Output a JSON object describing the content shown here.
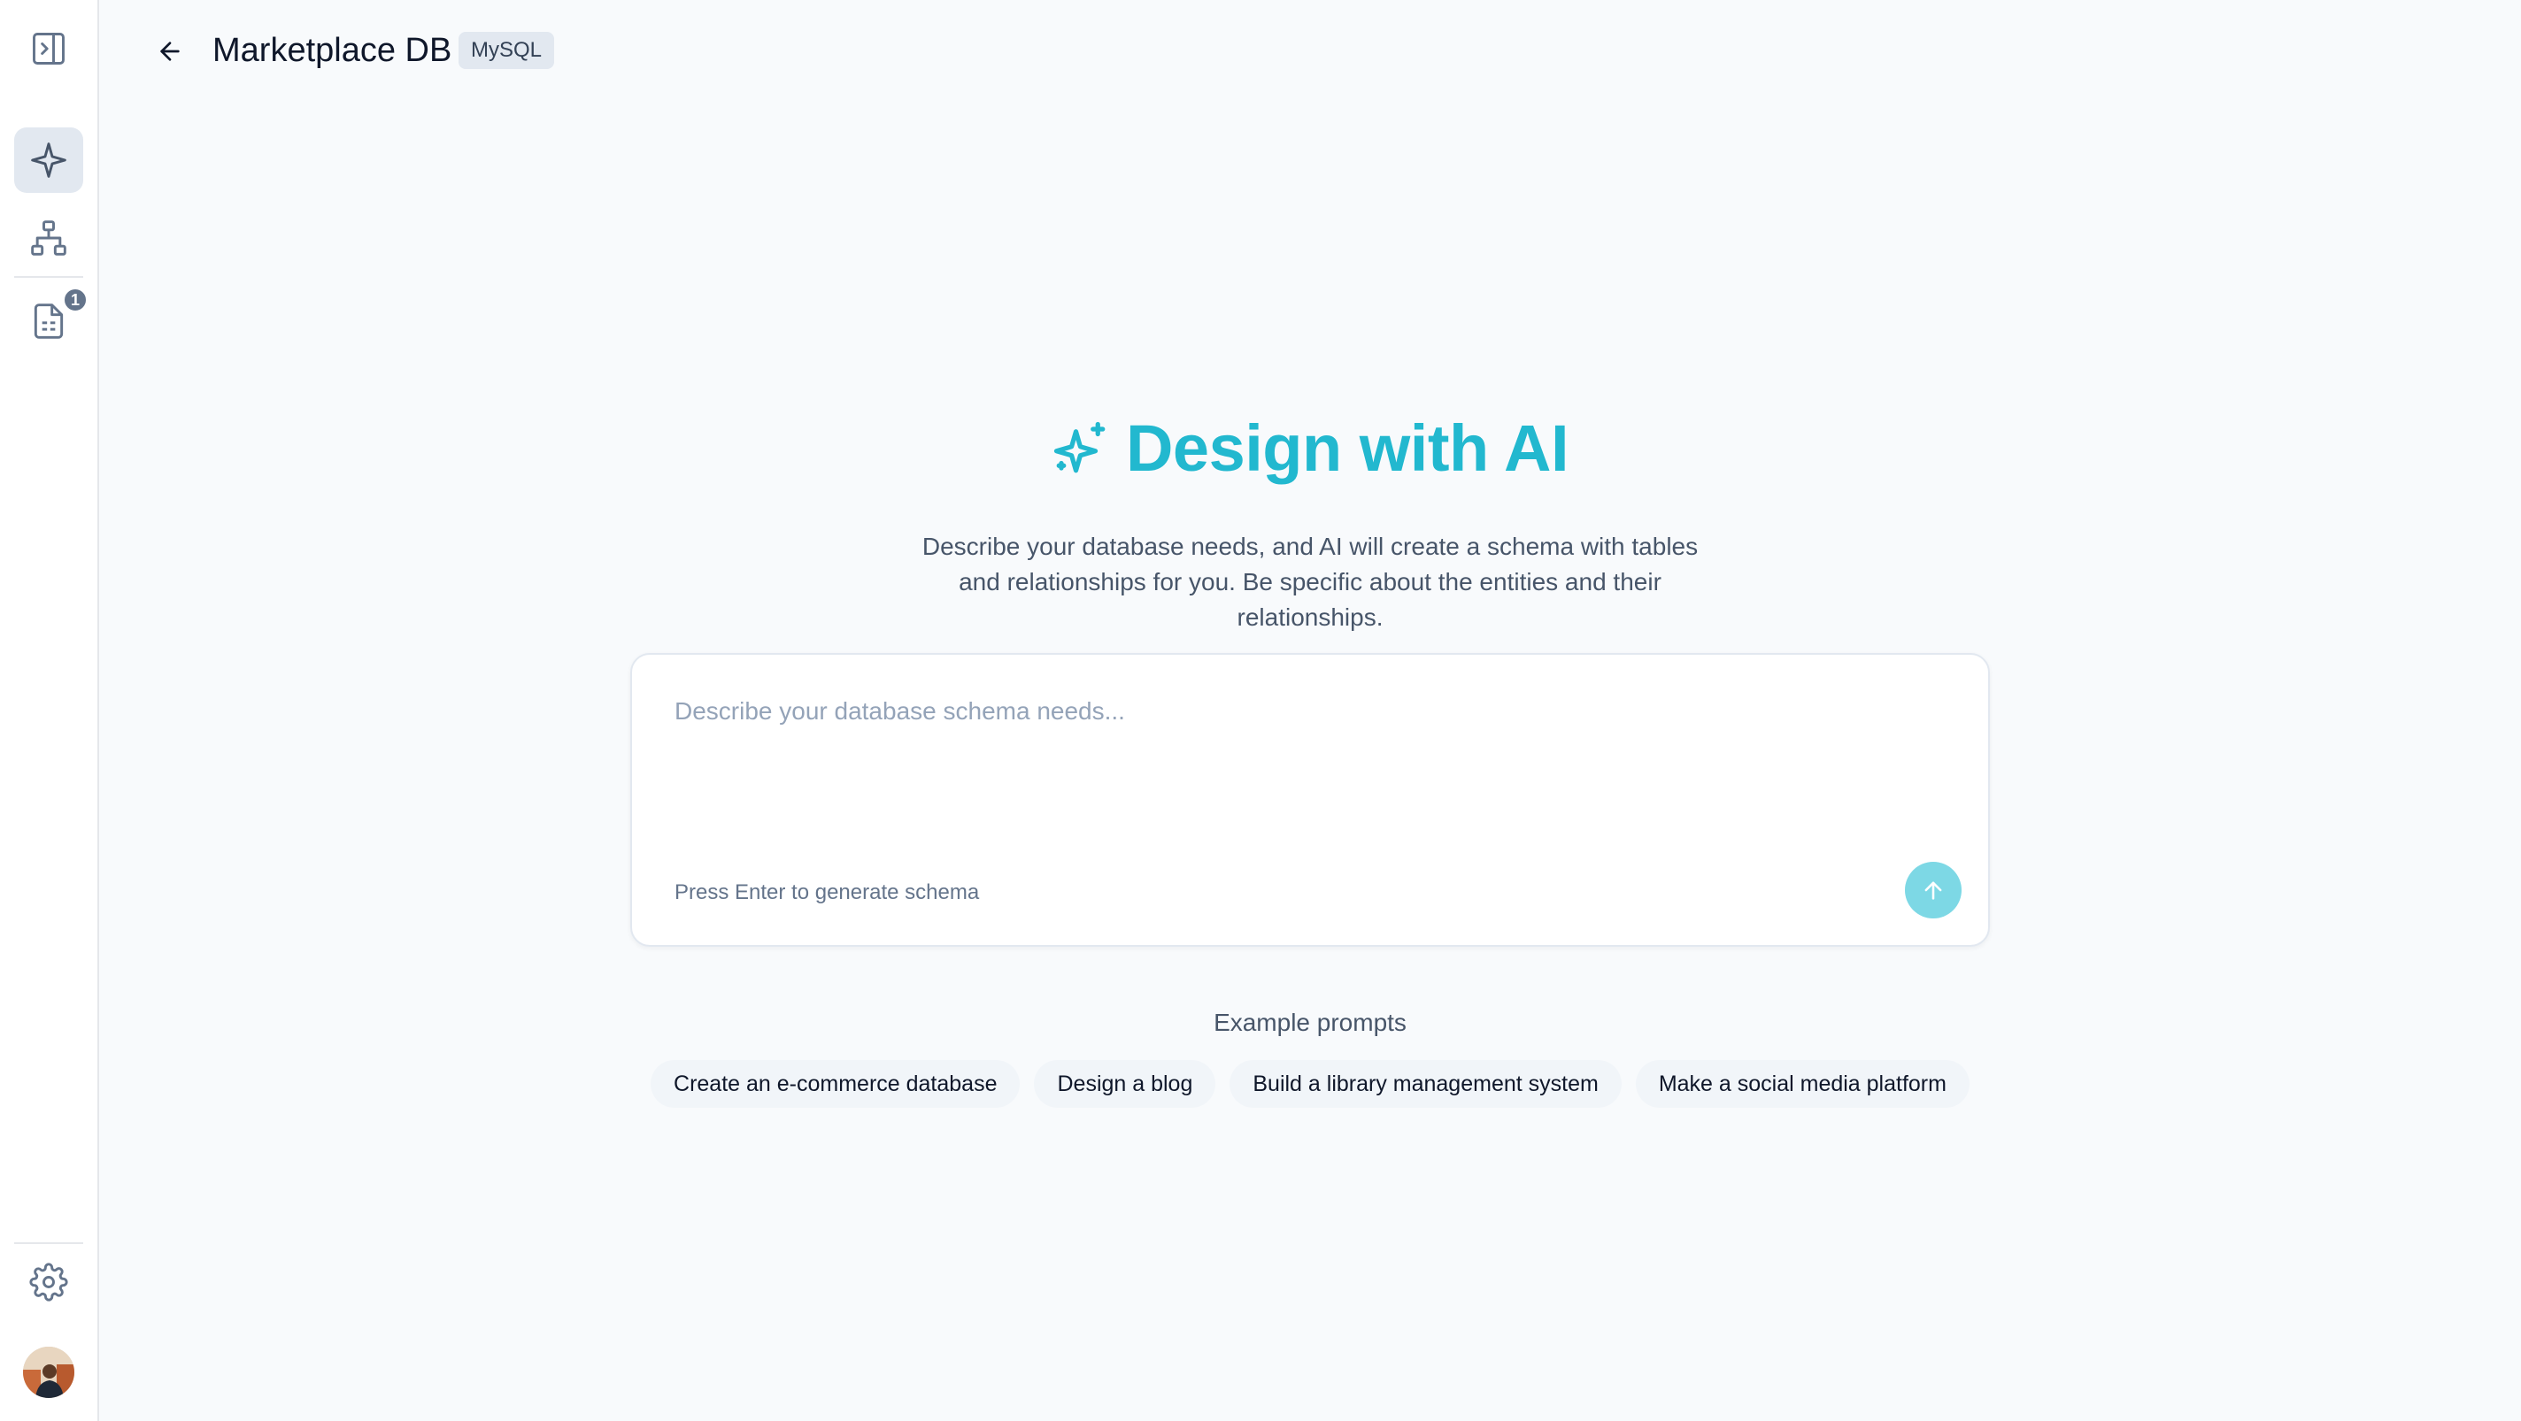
{
  "header": {
    "title": "Marketplace DB",
    "db_type": "MySQL"
  },
  "sidebar": {
    "items": [
      {
        "icon": "panel-toggle-icon"
      },
      {
        "icon": "sparkle-icon",
        "active": true
      },
      {
        "icon": "diagram-icon"
      },
      {
        "icon": "document-icon",
        "badge": "1"
      },
      {
        "icon": "gear-icon"
      },
      {
        "icon": "avatar"
      }
    ]
  },
  "hero": {
    "title": "Design with AI",
    "description": "Describe your database needs, and AI will create a schema with tables and relationships for you. Be specific about the entities and their relationships."
  },
  "prompt": {
    "value": "",
    "placeholder": "Describe your database schema needs...",
    "hint": "Press Enter to generate schema"
  },
  "examples": {
    "label": "Example prompts",
    "items": [
      "Create an e-commerce database",
      "Design a blog",
      "Build a library management system",
      "Make a social media platform"
    ]
  },
  "colors": {
    "accent": "#22b8cf",
    "send_button": "#7dd8e5",
    "rail_active": "#e2e8f0",
    "badge": "#64748b",
    "background": "#f8fafc"
  }
}
